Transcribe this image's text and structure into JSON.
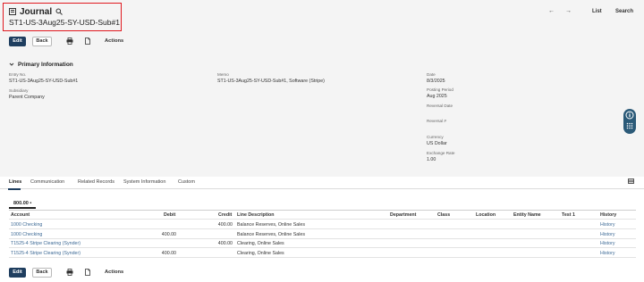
{
  "header": {
    "title": "Journal",
    "record_name": "ST1-US-3Aug25-SY-USD-Sub#1",
    "list_label": "List",
    "search_label": "Search"
  },
  "toolbar": {
    "edit_label": "Edit",
    "back_label": "Back",
    "actions_label": "Actions"
  },
  "primary": {
    "section_title": "Primary Information",
    "entry_no_label": "Entry No.",
    "entry_no_value": "ST1-US-3Aug25-SY-USD-Sub#1",
    "subsidiary_label": "Subsidiary",
    "subsidiary_value": "Parent Company",
    "memo_label": "Memo",
    "memo_value": "ST1-US-3Aug25-SY-USD-Sub#1, Software (Stripe)",
    "date_label": "Date",
    "date_value": "8/3/2025",
    "posting_period_label": "Posting Period",
    "posting_period_value": "Aug 2025",
    "reversal_date_label": "Reversal Date",
    "reversal_no_label": "Reversal #",
    "currency_label": "Currency",
    "currency_value": "US Dollar",
    "exchange_rate_label": "Exchange Rate",
    "exchange_rate_value": "1.00"
  },
  "tabs": [
    "Lines",
    "Communication",
    "Related Records",
    "System Information",
    "Custom"
  ],
  "lines": {
    "subtab_label": "800.00 •",
    "columns": [
      "Account",
      "Debit",
      "Credit",
      "Line Description",
      "Department",
      "Class",
      "Location",
      "Entity Name",
      "Test 1",
      "History"
    ],
    "rows": [
      {
        "account": "1000 Checking",
        "debit": "",
        "credit": "400.00",
        "desc": "Balance Reserves, Online Sales",
        "history": "History"
      },
      {
        "account": "1000 Checking",
        "debit": "400.00",
        "credit": "",
        "desc": "Balance Reserves, Online Sales",
        "history": "History"
      },
      {
        "account": "T1525-4 Stripe Clearing (Synder)",
        "debit": "",
        "credit": "400.00",
        "desc": "Clearing, Online Sales",
        "history": "History"
      },
      {
        "account": "T1525-4 Stripe Clearing (Synder)",
        "debit": "400.00",
        "credit": "",
        "desc": "Clearing, Online Sales",
        "history": "History"
      }
    ]
  },
  "colors": {
    "primary_button": "#1f3e5f",
    "highlight_box": "#e0191f",
    "link": "#3d6a96"
  },
  "icons": [
    "record-icon",
    "search-icon",
    "arrow-left-icon",
    "arrow-right-icon",
    "print-icon",
    "pdf-icon",
    "chevron-down-icon",
    "help-icon",
    "table-view-icon"
  ]
}
